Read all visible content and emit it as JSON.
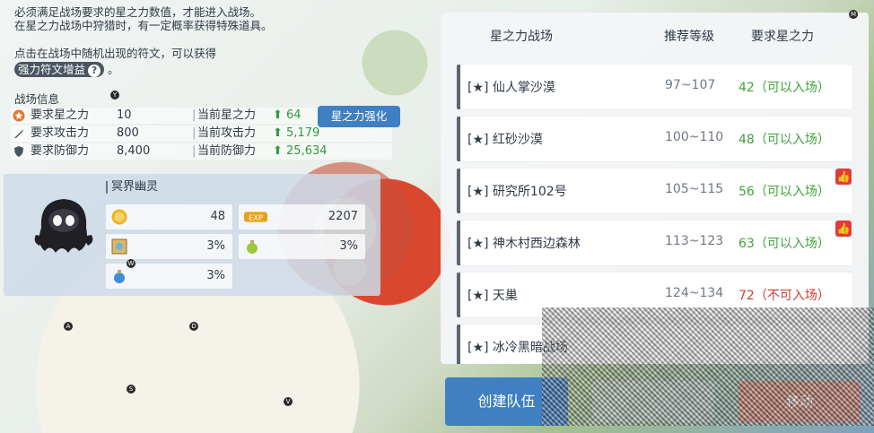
{
  "info": {
    "line1": "必须满足战场要求的星之力数值，才能进入战场。",
    "line2": "在星之力战场中狩猎时，有一定概率获得特殊道具。",
    "line3": "点击在战场中随机出现的符文，可以获得",
    "chip": "强力符文增益",
    "tail": "。"
  },
  "battle_info": {
    "title": "战场信息",
    "rows": [
      {
        "label": "要求星之力",
        "value": "10",
        "label2": "当前星之力",
        "value2": "64"
      },
      {
        "label": "要求攻击力",
        "value": "800",
        "label2": "当前攻击力",
        "value2": "5,179"
      },
      {
        "label": "要求防御力",
        "value": "8,400",
        "label2": "当前防御力",
        "value2": "25,634"
      }
    ],
    "boost_button": "星之力强化"
  },
  "monster": {
    "name": "冥界幽灵",
    "stats": [
      {
        "icon": "gold-coin-icon",
        "value": "48"
      },
      {
        "icon": "exp-icon",
        "value": "2207"
      },
      {
        "icon": "rune-scroll-icon",
        "value": "3%"
      },
      {
        "icon": "green-potion-icon",
        "value": "3%"
      },
      {
        "icon": "blue-potion-icon",
        "value": "3%"
      }
    ]
  },
  "panel": {
    "headers": {
      "name": "星之力战场",
      "level": "推荐等级",
      "req": "要求星之力"
    },
    "rows": [
      {
        "name": "[★] 仙人掌沙漠",
        "level": "97~107",
        "req": "42（可以入场）",
        "status": "ok",
        "recommended": false
      },
      {
        "name": "[★] 红砂沙漠",
        "level": "100~110",
        "req": "48（可以入场）",
        "status": "ok",
        "recommended": false
      },
      {
        "name": "[★] 研究所102号",
        "level": "105~115",
        "req": "56（可以入场）",
        "status": "ok",
        "recommended": true
      },
      {
        "name": "[★] 神木村西边森林",
        "level": "113~123",
        "req": "63（可以入场）",
        "status": "ok",
        "recommended": true
      },
      {
        "name": "[★] 天巢",
        "level": "124~134",
        "req": "72（不可入场）",
        "status": "no",
        "recommended": false
      },
      {
        "name": "[★] 冰冷黑暗战场",
        "level": "",
        "req": "",
        "status": "no",
        "recommended": false
      }
    ]
  },
  "buttons": {
    "create_team": "创建队伍",
    "middle": "",
    "enter": "移动"
  },
  "colors": {
    "accent_blue": "#3f7fc2",
    "ok_green": "#3fa33b",
    "no_red": "#d13b34",
    "up_green": "#2d9a3c"
  }
}
